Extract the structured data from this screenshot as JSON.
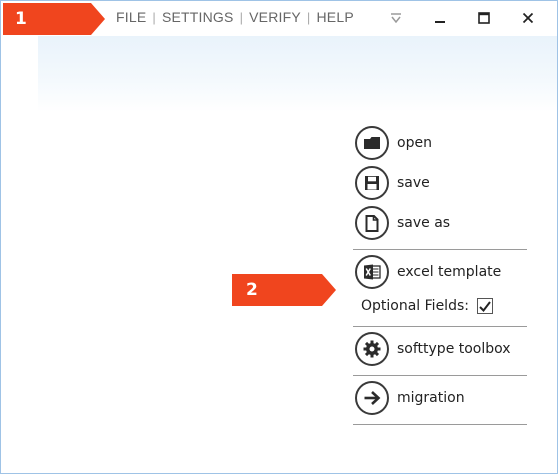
{
  "callouts": {
    "step1": "1",
    "step2": "2"
  },
  "menu": {
    "items": [
      {
        "label": "FILE"
      },
      {
        "label": "SETTINGS"
      },
      {
        "label": "VERIFY"
      },
      {
        "label": "HELP"
      }
    ],
    "separator": "|"
  },
  "window_controls": {
    "icons": [
      "dropdown-icon",
      "minimize-icon",
      "maximize-icon",
      "close-icon"
    ]
  },
  "file_panel": {
    "open_label": "open",
    "save_label": "save",
    "save_as_label": "save as",
    "excel_template_label": "excel template",
    "optional_fields_label": "Optional Fields:",
    "optional_fields_checked": true,
    "softtype_toolbox_label": "softtype toolbox",
    "migration_label": "migration"
  },
  "colors": {
    "callout": "#f0451e",
    "menu_text": "#666666",
    "icon_stroke": "#3a3a3a",
    "header_gradient": "#e9f3fb"
  }
}
